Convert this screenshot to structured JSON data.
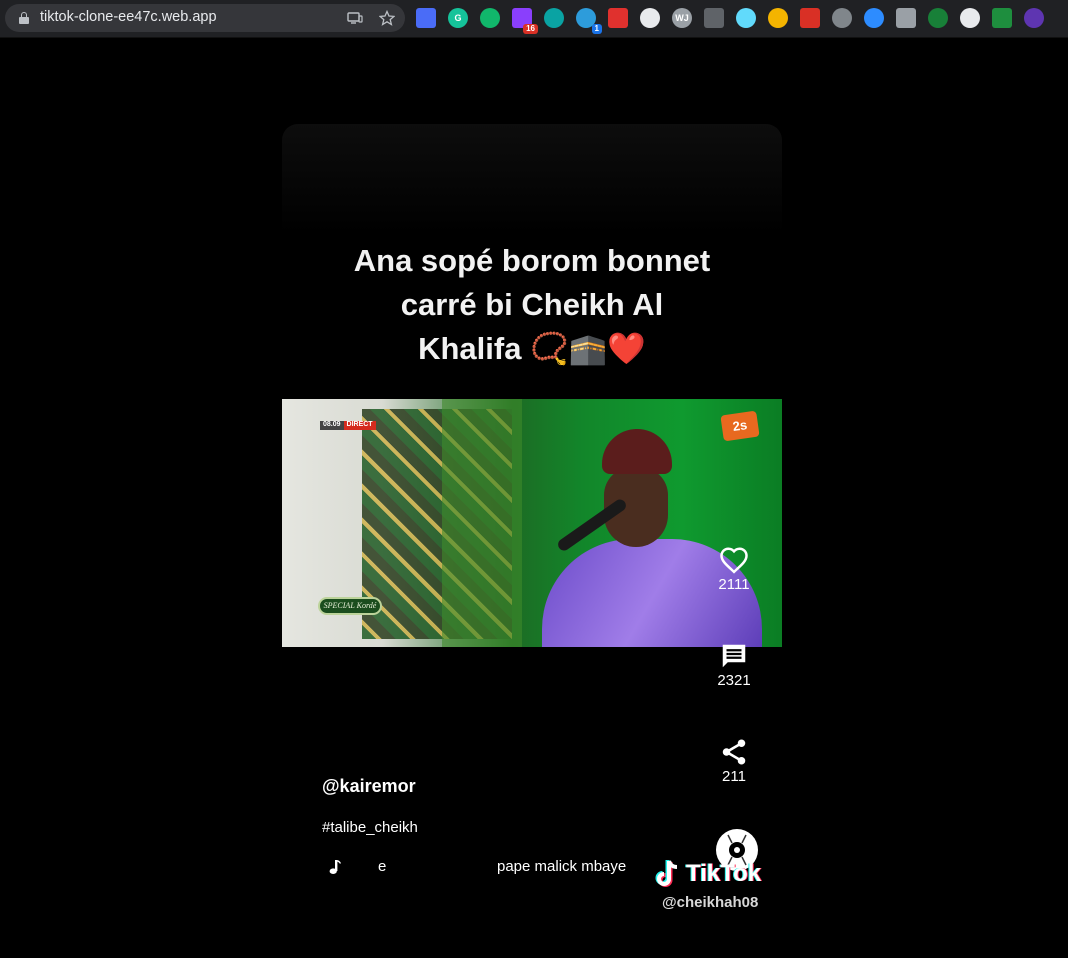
{
  "browser": {
    "url": "tiktok-clone-ee47c.web.app",
    "extensions": [
      {
        "name": "ext-1",
        "color": "#4a6cf7",
        "glyph": ""
      },
      {
        "name": "ext-2",
        "color": "#15c39a",
        "glyph": "G"
      },
      {
        "name": "ext-3",
        "color": "#11b76b",
        "glyph": ""
      },
      {
        "name": "ext-4",
        "color": "#8a3ffc",
        "glyph": "",
        "badge": "16"
      },
      {
        "name": "ext-5",
        "color": "#0aa3a3",
        "glyph": ""
      },
      {
        "name": "ext-6",
        "color": "#2d9cdb",
        "glyph": "",
        "badge": "1"
      },
      {
        "name": "ext-7",
        "color": "#e0312e",
        "glyph": ""
      },
      {
        "name": "ext-8",
        "color": "#e8eaed",
        "glyph": ""
      },
      {
        "name": "ext-9",
        "color": "#9aa0a6",
        "glyph": "WJ"
      },
      {
        "name": "ext-10",
        "color": "#5f6368",
        "glyph": ""
      },
      {
        "name": "ext-11",
        "color": "#61dafb",
        "glyph": ""
      },
      {
        "name": "ext-12",
        "color": "#f4b400",
        "glyph": ""
      },
      {
        "name": "ext-13",
        "color": "#d93025",
        "glyph": ""
      },
      {
        "name": "ext-14",
        "color": "#80868b",
        "glyph": ""
      },
      {
        "name": "ext-15",
        "color": "#2d8cff",
        "glyph": ""
      },
      {
        "name": "ext-16",
        "color": "#9aa0a6",
        "glyph": ""
      },
      {
        "name": "ext-17",
        "color": "#188038",
        "glyph": ""
      },
      {
        "name": "ext-18",
        "color": "#e8eaed",
        "glyph": ""
      },
      {
        "name": "ext-19",
        "color": "#1e8e3e",
        "glyph": ""
      },
      {
        "name": "ext-20",
        "color": "#5e35b1",
        "glyph": ""
      }
    ]
  },
  "video": {
    "caption_line1": "Ana sopé borom bonnet",
    "caption_line2": "carré bi Cheikh Al",
    "caption_line3": "Khalifa 📿🕋❤️",
    "overlay_time": "08.09",
    "overlay_live": "DIRECT",
    "overlay_channel": "2s",
    "overlay_badge": "SPECIAL Kordé"
  },
  "actions": {
    "likes": "2111",
    "comments": "2321",
    "shares": "211"
  },
  "post": {
    "username": "@kairemor",
    "hashtag": "#talibe_cheikh",
    "music_fragment": "e",
    "music_title": "pape malick mbaye"
  },
  "watermark": {
    "brand": "TikTok",
    "handle": "@cheikhah08"
  },
  "colors": {
    "background": "#000000",
    "text": "#ffffff",
    "tiktok_cyan": "#25f4ee",
    "tiktok_red": "#fe2c55"
  }
}
